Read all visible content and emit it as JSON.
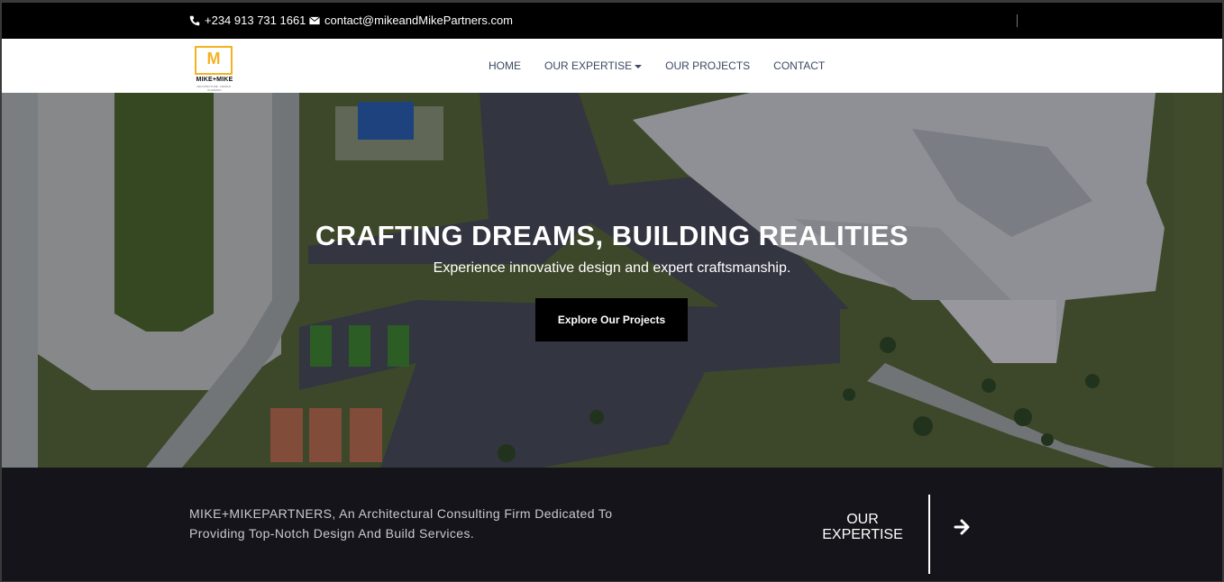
{
  "topbar": {
    "phone": "+234 913 731 1661",
    "email": "contact@mikeandMikePartners.com",
    "phone_icon": "phone-icon",
    "email_icon": "envelope-icon"
  },
  "logo": {
    "letter": "M",
    "name": "MIKE+MIKE",
    "tagline": "ARCHITECTURE · DESIGN · PLANNING"
  },
  "nav": {
    "items": [
      {
        "label": "HOME"
      },
      {
        "label": "OUR EXPERTISE",
        "has_dropdown": true
      },
      {
        "label": "OUR PROJECTS"
      },
      {
        "label": "CONTACT"
      }
    ]
  },
  "hero": {
    "title": "CRAFTING DREAMS, BUILDING REALITIES",
    "subtitle": "Experience innovative design and expert craftsmanship.",
    "cta": "Explore Our Projects"
  },
  "band": {
    "description": "MIKE+MIKEPARTNERS, An Architectural Consulting Firm Dedicated To Providing Top-Notch Design And Build Services.",
    "expertise_line1": "OUR",
    "expertise_line2": "EXPERTISE",
    "arrow_icon": "arrow-right-icon"
  },
  "colors": {
    "accent": "#f4b223",
    "nav_text": "#3b4a63",
    "band_bg": "#15141b"
  }
}
